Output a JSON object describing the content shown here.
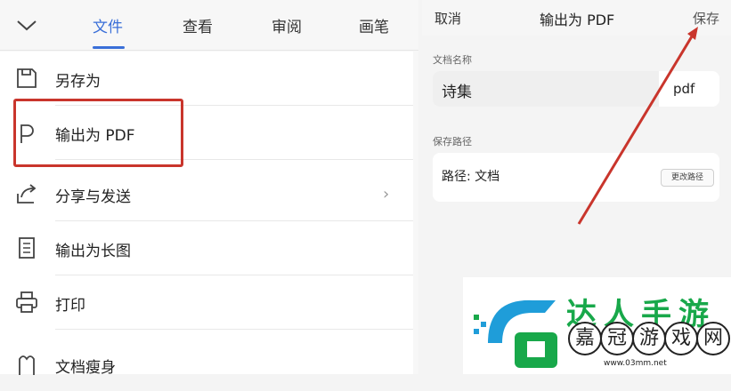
{
  "tabs": [
    "文件",
    "查看",
    "审阅",
    "画笔"
  ],
  "menu": [
    {
      "icon": "save-as-icon",
      "label": "另存为"
    },
    {
      "icon": "pdf-export-icon",
      "label": "输出为 PDF"
    },
    {
      "icon": "share-icon",
      "label": "分享与发送"
    },
    {
      "icon": "long-image-icon",
      "label": "输出为长图"
    },
    {
      "icon": "printer-icon",
      "label": "打印"
    },
    {
      "icon": "slim-document-icon",
      "label": "文档瘦身"
    }
  ],
  "share_chevron": "›",
  "dialog": {
    "cancel": "取消",
    "title": "输出为 PDF",
    "save": "保存",
    "name_label": "文档名称",
    "name_value": "诗集",
    "extension": "pdf",
    "path_label": "保存路径",
    "path_value": "路径: 文档",
    "change_path": "更改路径"
  },
  "watermark": {
    "line1": "达人手游",
    "chars": [
      "嘉",
      "冠",
      "游",
      "戏",
      "网"
    ],
    "url": "www.03mm.net"
  },
  "colors": {
    "accent": "#3a6fd8",
    "highlight": "#c9352c",
    "brand": "#18a84a"
  }
}
